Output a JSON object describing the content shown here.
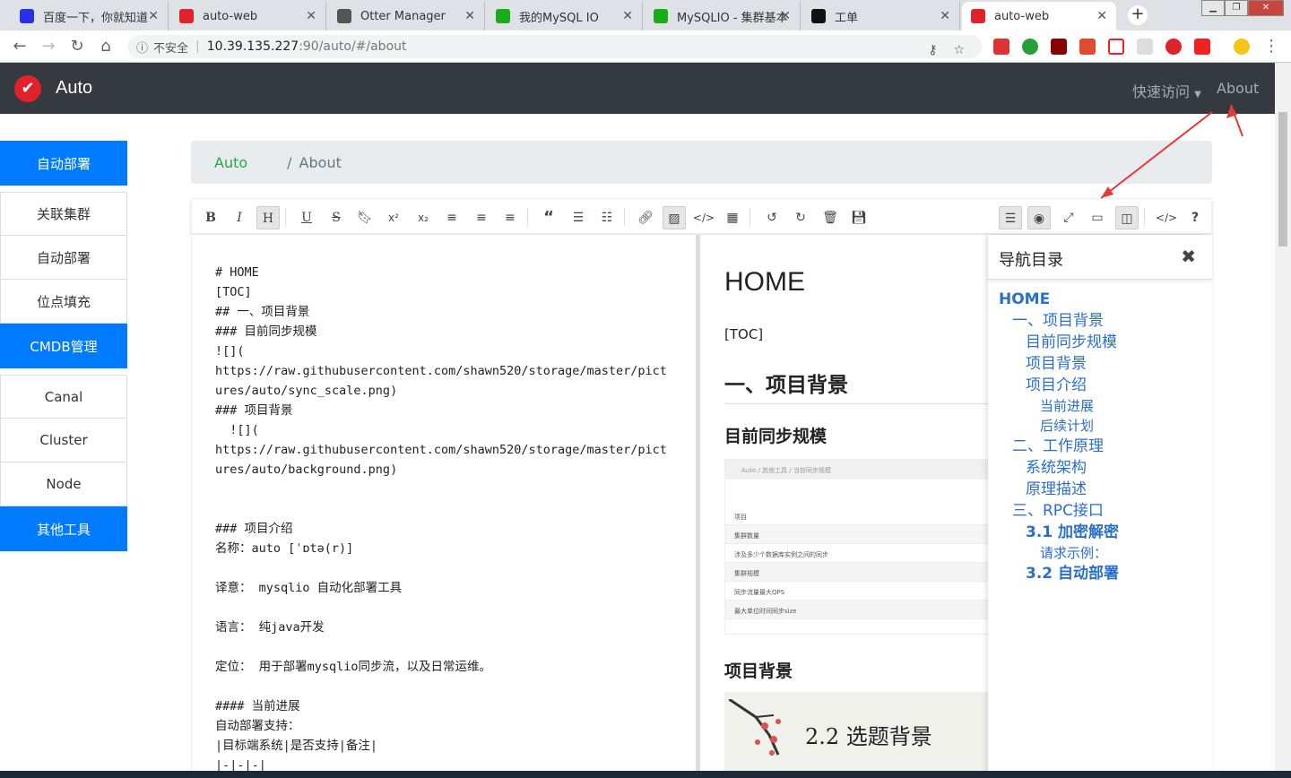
{
  "browser": {
    "tabs": [
      {
        "title": "百度一下，你就知道",
        "favicon": "baidu-icon",
        "color": "#2932e1"
      },
      {
        "title": "auto-web",
        "favicon": "auto-logo-icon",
        "color": "#e0222b"
      },
      {
        "title": "Otter Manager",
        "favicon": "globe-icon",
        "color": "#555555"
      },
      {
        "title": "我的MySQL IO",
        "favicon": "iq-icon",
        "color": "#1aad19"
      },
      {
        "title": "MySQLIO - 集群基本",
        "favicon": "iq-icon",
        "color": "#1aad19"
      },
      {
        "title": "工单",
        "favicon": "ticket-icon",
        "color": "#111111"
      },
      {
        "title": "auto-web",
        "favicon": "auto-logo-icon",
        "color": "#e0222b"
      }
    ],
    "address": {
      "insecure": "不安全",
      "host": "10.39.135.227",
      "path": ":90/auto/#/about"
    }
  },
  "app": {
    "brand": "Auto",
    "nav": {
      "quick_access": "快速访问",
      "about": "About"
    },
    "accent": "#007bff"
  },
  "sidebar": {
    "groups": [
      {
        "head": "自动部署",
        "items": [
          "关联集群",
          "自动部署",
          "位点填充"
        ]
      },
      {
        "head": "CMDB管理",
        "items": [
          "Canal",
          "Cluster",
          "Node"
        ]
      },
      {
        "head": "其他工具",
        "items": []
      }
    ]
  },
  "breadcrumb": {
    "root": "Auto",
    "current": "About"
  },
  "toolbar": {
    "buttons": [
      "bold",
      "italic",
      "heading",
      "underline",
      "strikethrough",
      "mark",
      "superscript",
      "subscript",
      "align-left",
      "align-center",
      "align-right",
      "quote",
      "ordered-list",
      "unordered-list",
      "link",
      "image",
      "code",
      "table",
      "undo",
      "redo",
      "trash",
      "save",
      "navigation",
      "preview",
      "fullscreen",
      "read-mode",
      "subfield",
      "html-code",
      "help"
    ]
  },
  "editor": {
    "lines": [
      "# HOME",
      "[TOC]",
      "## 一、项目背景",
      "### 目前同步规模",
      "![](",
      "https://raw.githubusercontent.com/shawn520/storage/master/pict",
      "ures/auto/sync_scale.png)",
      "### 项目背景",
      "  ![](",
      "https://raw.githubusercontent.com/shawn520/storage/master/pict",
      "ures/auto/background.png)",
      "",
      "",
      "### 项目介绍",
      "名称：auto [ˈɒtə(r)]",
      "",
      "译意： mysqlio 自动化部署工具",
      "",
      "语言： 纯java开发",
      "",
      "定位： 用于部署mysqlio同步流，以及日常运维。",
      "",
      "#### 当前进展",
      "自动部署支持：",
      "|目标端系统|是否支持|备注|",
      "|-|-|-|"
    ]
  },
  "preview": {
    "h1": "HOME",
    "toc": "[TOC]",
    "h2": "一、项目背景",
    "h3_sync": "目前同步规模",
    "h3_bg": "项目背景",
    "image1": {
      "breadcrumb": "Auto   /  其他工具  /  当前同步规模",
      "rows": [
        "项目",
        "集群数量",
        "涉及多少个数据库实例之间的同步",
        "集群规模",
        "同步流量最大QPS",
        "最大单位时间同步size"
      ]
    },
    "image2_caption": "2.2 选题背景"
  },
  "toc_panel": {
    "title": "导航目录",
    "close": "✖",
    "items": [
      {
        "text": "HOME",
        "level": "l1"
      },
      {
        "text": "一、项目背景",
        "level": "l2"
      },
      {
        "text": "目前同步规模",
        "level": "l3"
      },
      {
        "text": "项目背景",
        "level": "l3"
      },
      {
        "text": "项目介绍",
        "level": "l3"
      },
      {
        "text": "当前进展",
        "level": "l4"
      },
      {
        "text": "后续计划",
        "level": "l4"
      },
      {
        "text": "二、工作原理",
        "level": "l2"
      },
      {
        "text": "系统架构",
        "level": "l3"
      },
      {
        "text": "原理描述",
        "level": "l3"
      },
      {
        "text": "三、RPC接口",
        "level": "l2"
      },
      {
        "text": "3.1 加密解密",
        "level": "l3 b"
      },
      {
        "text": "请求示例：",
        "level": "l4"
      },
      {
        "text": "3.2 自动部署",
        "level": "l3 b"
      }
    ]
  }
}
